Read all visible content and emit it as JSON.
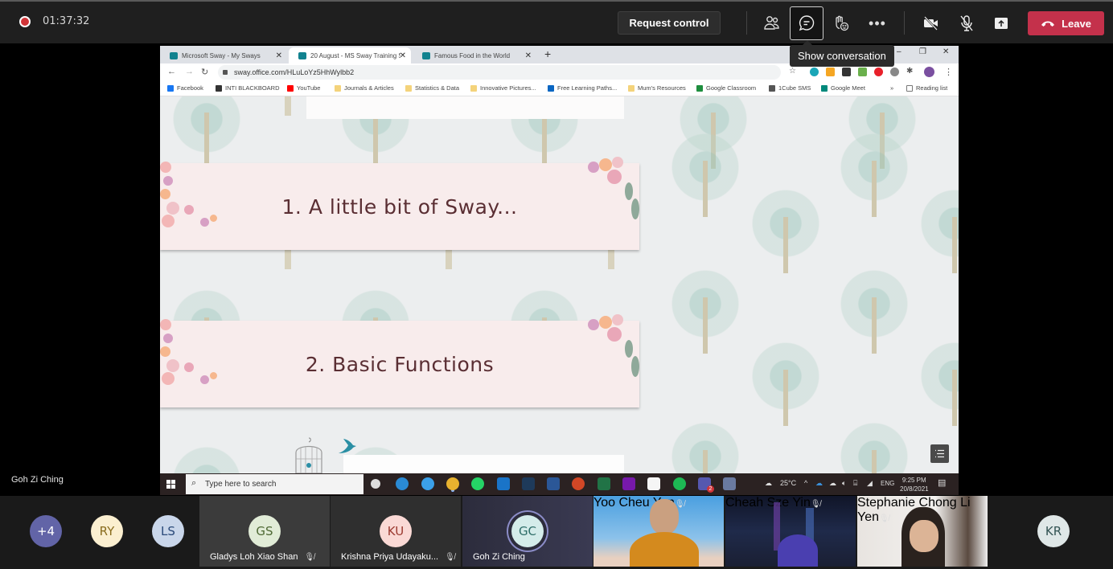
{
  "topbar": {
    "recording_indicator": "recording-icon",
    "timer": "01:37:32",
    "request_control_label": "Request control",
    "buttons": [
      {
        "name": "participants",
        "icon": "people-icon"
      },
      {
        "name": "conversation",
        "icon": "chat-icon",
        "active": true
      },
      {
        "name": "reactions",
        "icon": "raise-hand-icon"
      },
      {
        "name": "more",
        "icon": "more-icon"
      },
      {
        "name": "camera",
        "icon": "camera-off-icon"
      },
      {
        "name": "mic",
        "icon": "mic-off-icon"
      },
      {
        "name": "share",
        "icon": "share-tray-icon"
      }
    ],
    "leave_label": "Leave",
    "tooltip": "Show conversation"
  },
  "browser": {
    "tabs": [
      {
        "title": "Microsoft Sway - My Sways",
        "active": false
      },
      {
        "title": "20 August - MS Sway Training Se",
        "active": true
      },
      {
        "title": "Famous Food in the World",
        "active": false
      }
    ],
    "new_tab": "+",
    "window_controls": [
      "–",
      "❐",
      "✕"
    ],
    "url": "sway.office.com/HLuLoYz5HhWylbb2",
    "bookmarks": [
      {
        "label": "Facebook",
        "color": "#1877f2"
      },
      {
        "label": "INTI BLACKBOARD",
        "color": "#333333"
      },
      {
        "label": "YouTube",
        "color": "#ff0000"
      },
      {
        "label": "Journals & Articles",
        "color": "#f4d37b"
      },
      {
        "label": "Statistics & Data",
        "color": "#f4d37b"
      },
      {
        "label": "Innovative Pictures...",
        "color": "#f4d37b"
      },
      {
        "label": "Free Learning Paths...",
        "color": "#0a66c2"
      },
      {
        "label": "Mum's Resources",
        "color": "#f4d37b"
      },
      {
        "label": "Google Classroom",
        "color": "#1e8e3e"
      },
      {
        "label": "1Cube SMS",
        "color": "#555555"
      },
      {
        "label": "Google Meet",
        "color": "#00897b"
      }
    ],
    "bookmarks_overflow": "»",
    "reading_list": "Reading list"
  },
  "sway": {
    "sections": [
      {
        "title": "1. A little bit of Sway..."
      },
      {
        "title": "2. Basic Functions"
      }
    ],
    "toc_button": "navigation-icon"
  },
  "taskbar": {
    "search_placeholder": "Type here to search",
    "apps": [
      "settings",
      "edge",
      "internet-explorer",
      "chrome",
      "whatsapp",
      "outlook",
      "kindle",
      "word",
      "powerpoint",
      "excel",
      "onenote",
      "notion",
      "spotify",
      "teams",
      "camera"
    ],
    "teams_badge": "2",
    "weather": "25°C",
    "language": "ENG",
    "time": "9:25 PM",
    "date": "20/8/2021"
  },
  "presenter_name": "Goh Zi Ching",
  "participants": {
    "overflow": {
      "initials": "+4",
      "color": "#6264a7",
      "text_color": "#ffffff"
    },
    "avatars_small": [
      {
        "initials": "RY",
        "color": "#fbefd0",
        "text_color": "#8a6d1e"
      },
      {
        "initials": "LS",
        "color": "#c9d6ea",
        "text_color": "#2b4a7a"
      }
    ],
    "tiles": [
      {
        "name": "Gladys Loh Xiao Shan",
        "initials": "GS",
        "color": "#e1ecd7",
        "text_color": "#4f6a35",
        "muted": true
      },
      {
        "name": "Krishna Priya Udayaku...",
        "initials": "KU",
        "color": "#fad9d5",
        "text_color": "#9b3a30",
        "muted": true
      },
      {
        "name": "Goh Zi Ching",
        "initials": "GC",
        "color": "#d4ecea",
        "text_color": "#2f6f6a",
        "muted": false,
        "speaking": true
      },
      {
        "name": "Yoo Cheu Yen",
        "muted": true,
        "video": true
      },
      {
        "name": "Cheah Sze Yin",
        "muted": true,
        "video": true
      },
      {
        "name": "Stephanie Chong Li Yen",
        "muted": true,
        "video": true
      }
    ],
    "last": {
      "initials": "KR",
      "color": "#dfe7e7",
      "text_color": "#345454"
    }
  }
}
